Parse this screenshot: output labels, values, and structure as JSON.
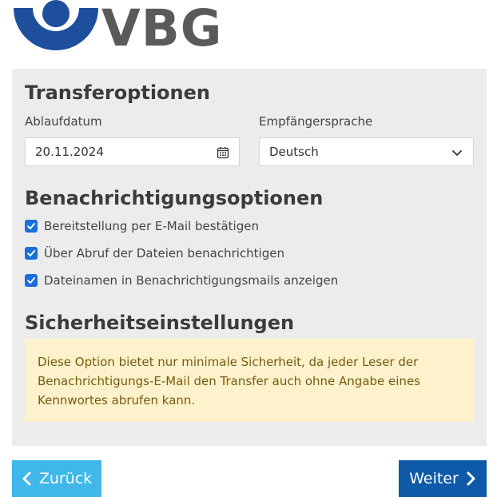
{
  "brand": {
    "logo_text": "VBG",
    "colors": {
      "logo_blue": "#1d4f9c",
      "logo_gray": "#5a5a5a"
    }
  },
  "transfer": {
    "title": "Transferoptionen",
    "expiry_label": "Ablaufdatum",
    "expiry_value": "20.11.2024",
    "language_label": "Empfängersprache",
    "language_value": "Deutsch"
  },
  "notifications": {
    "title": "Benachrichtigungsoptionen",
    "options": [
      {
        "label": "Bereitstellung per E-Mail bestätigen",
        "checked": true
      },
      {
        "label": "Über Abruf der Dateien benachrichtigen",
        "checked": true
      },
      {
        "label": "Dateinamen in Benachrichtigungsmails anzeigen",
        "checked": true
      }
    ]
  },
  "security": {
    "title": "Sicherheitseinstellungen",
    "warning_lines": [
      "Diese Option bietet nur minimale Sicherheit, da jeder Leser der",
      "Benachrichtigungs-E-Mail den Transfer auch ohne Angabe eines",
      "Kennwortes abrufen kann."
    ]
  },
  "nav": {
    "back_label": "Zurück",
    "next_label": "Weiter",
    "colors": {
      "back": "#3fb7ea",
      "next": "#0f5aa8"
    }
  },
  "icons": {
    "calendar": "calendar-icon",
    "dropdown": "chevron-down-icon",
    "back": "chevron-left-icon",
    "next": "chevron-right-icon",
    "checkbox": "checkmark-icon"
  }
}
